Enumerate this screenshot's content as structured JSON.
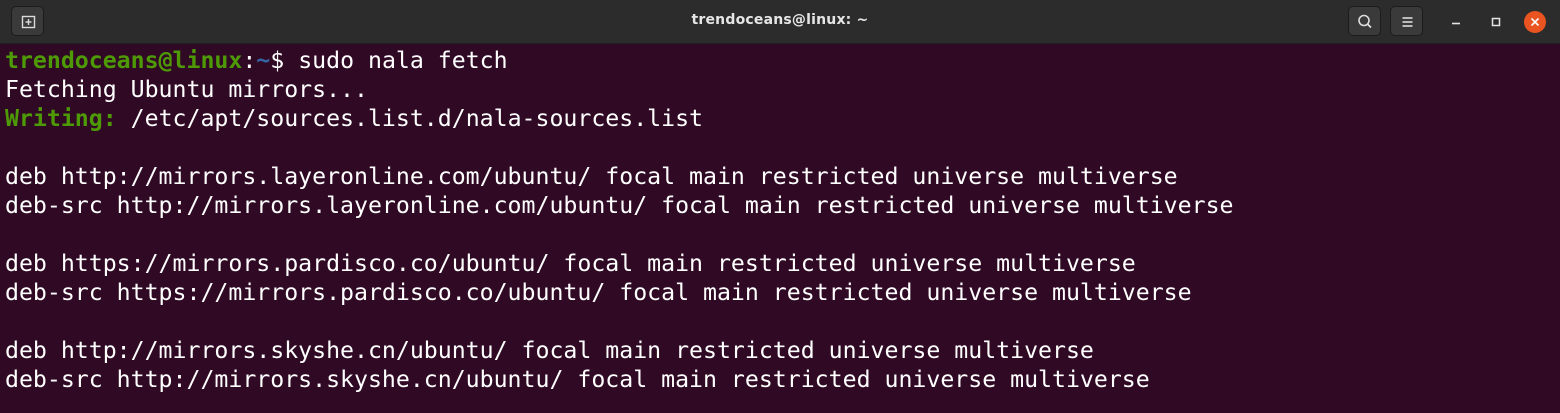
{
  "window": {
    "title": "trendoceans@linux: ~"
  },
  "icons": {
    "new_tab": "new-tab-icon",
    "search": "search-icon",
    "menu": "hamburger-menu-icon",
    "minimize": "minimize-icon",
    "maximize": "maximize-icon",
    "close": "close-icon"
  },
  "colors": {
    "terminal_bg": "#300a24",
    "titlebar_bg": "#2c2c2c",
    "prompt_green": "#4e9a06",
    "prompt_blue": "#3465a4",
    "close_orange": "#e95420"
  },
  "prompt": {
    "user_host": "trendoceans@linux",
    "colon": ":",
    "path": "~",
    "symbol": "$ ",
    "command": "sudo nala fetch"
  },
  "output": {
    "fetching": "Fetching Ubuntu mirrors...",
    "writing_label": "Writing:",
    "writing_path": " /etc/apt/sources.list.d/nala-sources.list",
    "mirror_lines": [
      "deb http://mirrors.layeronline.com/ubuntu/ focal main restricted universe multiverse",
      "deb-src http://mirrors.layeronline.com/ubuntu/ focal main restricted universe multiverse",
      "deb https://mirrors.pardisco.co/ubuntu/ focal main restricted universe multiverse",
      "deb-src https://mirrors.pardisco.co/ubuntu/ focal main restricted universe multiverse",
      "deb http://mirrors.skyshe.cn/ubuntu/ focal main restricted universe multiverse",
      "deb-src http://mirrors.skyshe.cn/ubuntu/ focal main restricted universe multiverse"
    ]
  }
}
